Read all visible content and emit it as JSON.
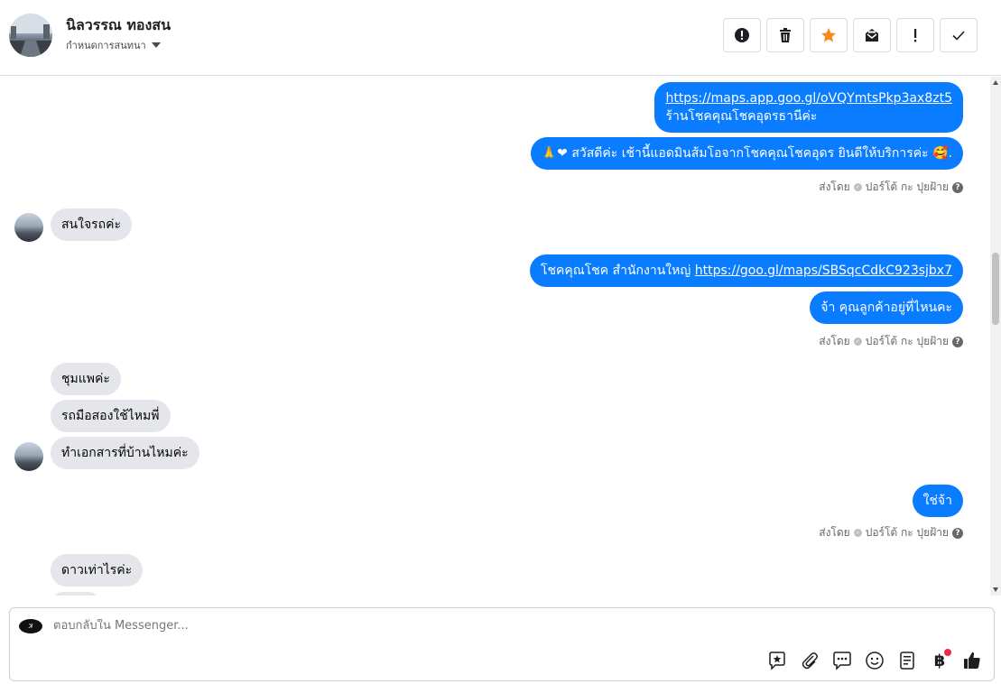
{
  "header": {
    "name": "นิลวรรณ ทองสน",
    "subtitle": "กำหนดการสนทนา",
    "actions": [
      "spam-icon",
      "trash-icon",
      "star-icon",
      "mail-read-icon",
      "exclamation-icon",
      "check-icon"
    ],
    "star_color": "#f58b1f"
  },
  "messages": {
    "out1_link": "https://maps.app.goo.gl/oVQYmtsPkp3ax8zt5",
    "out1_text": "ร้านโชคคุณโชคอุดรธานีค่ะ",
    "out2_emoji": "🙏❤",
    "out2_text": "สวัสดีค่ะ เช้านี้แอดมินส้มโอจากโชคคุณโชคอุดร ยินดีให้บริการค่ะ",
    "out2_emoji_end": "🥰.",
    "in1": "สนใจรถค่ะ",
    "out3_text": "โชคคุณโชค สำนักงานใหญ่ ",
    "out3_link": "https://goo.gl/maps/SBSqcCdkC923sjbx7",
    "out4": "จ้า คุณลูกค้าอยู่ที่ไหนคะ",
    "in2": "ชุมแพค่ะ",
    "in3": "รถมือสองใช้ไหมพี่",
    "in4": "ทำเอกสารที่บ้านไหมค่ะ",
    "out5": "ใช่จ้า",
    "in5": "ดาวเท่าไรค่ะ"
  },
  "sent_by": {
    "prefix": "ส่งโดย",
    "name": "ปอร์โต้ กะ ปุยฝ้าย",
    "help": "?"
  },
  "composer": {
    "placeholder": "ตอบกลับใน Messenger...",
    "tools": [
      "sticker-icon",
      "attach-icon",
      "saved-replies-icon",
      "emoji-icon",
      "notes-icon",
      "baht-icon",
      "like-icon"
    ],
    "baht": "฿"
  },
  "colors": {
    "outgoing_bubble": "#0a7cff",
    "incoming_bubble": "#e4e6eb",
    "notification_dot": "#f02849"
  }
}
